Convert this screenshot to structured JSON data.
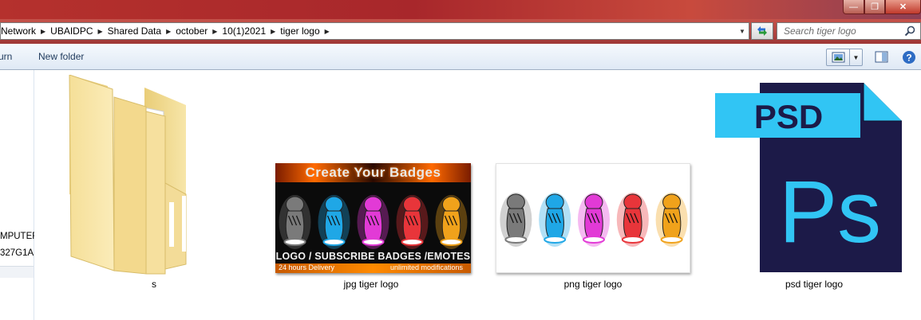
{
  "window": {
    "min_label": "—",
    "max_label": "❐",
    "close_label": "✕"
  },
  "address": {
    "crumbs": [
      "Network",
      "UBAIDPC",
      "Shared Data",
      "october",
      "10(1)2021",
      "tiger logo"
    ]
  },
  "search": {
    "placeholder": "Search tiger logo"
  },
  "toolbar": {
    "burn_label": "urn",
    "new_folder_label": "New folder"
  },
  "nav": {
    "item1": "MPUTER",
    "item2": "327G1A"
  },
  "files": [
    {
      "name": "s",
      "type": "folder"
    },
    {
      "name": "jpg tiger logo",
      "type": "jpg"
    },
    {
      "name": "png tiger logo",
      "type": "png"
    },
    {
      "name": "psd tiger logo",
      "type": "psd"
    }
  ],
  "jpg_thumb": {
    "title": "Create Your Badges",
    "subtitle": "LOGO / SUBSCRIBE BADGES /EMOTES",
    "foot_left": "24 hours Delivery",
    "foot_right": "unlimited modifications"
  },
  "psd": {
    "top_label": "PSD",
    "big_label": "Ps"
  },
  "tiger_colors": [
    "#7a7a7a",
    "#1fa7e6",
    "#e23ad6",
    "#e8353a",
    "#f0a21b"
  ],
  "colors": {
    "titlebar": "#a8272b",
    "psd_dark": "#1c1a48",
    "psd_accent": "#31c5f4"
  }
}
